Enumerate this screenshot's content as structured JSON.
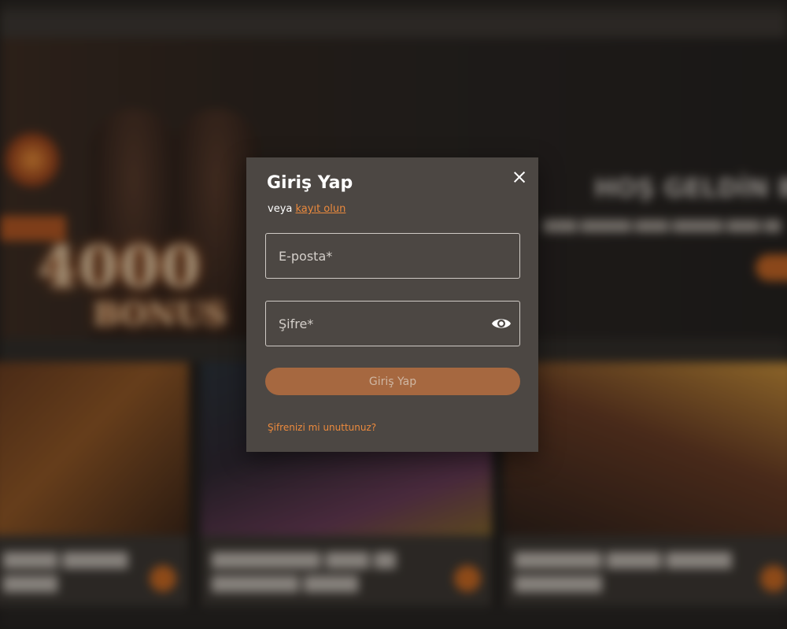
{
  "colors": {
    "accent": "#ec8a3d",
    "modal_bg": "#4c4743",
    "button_bg": "#a66840"
  },
  "login_modal": {
    "title": "Giriş Yap",
    "register_prefix": "veya",
    "register_link": "kayıt olun",
    "close_icon": "close-icon",
    "email_placeholder": "E-posta*",
    "email_value": "",
    "password_placeholder": "Şifre*",
    "password_value": "",
    "password_toggle_icon": "eye-icon",
    "submit_label": "Giriş Yap",
    "forgot_password": "Şifrenizi mi unuttunuz?"
  }
}
